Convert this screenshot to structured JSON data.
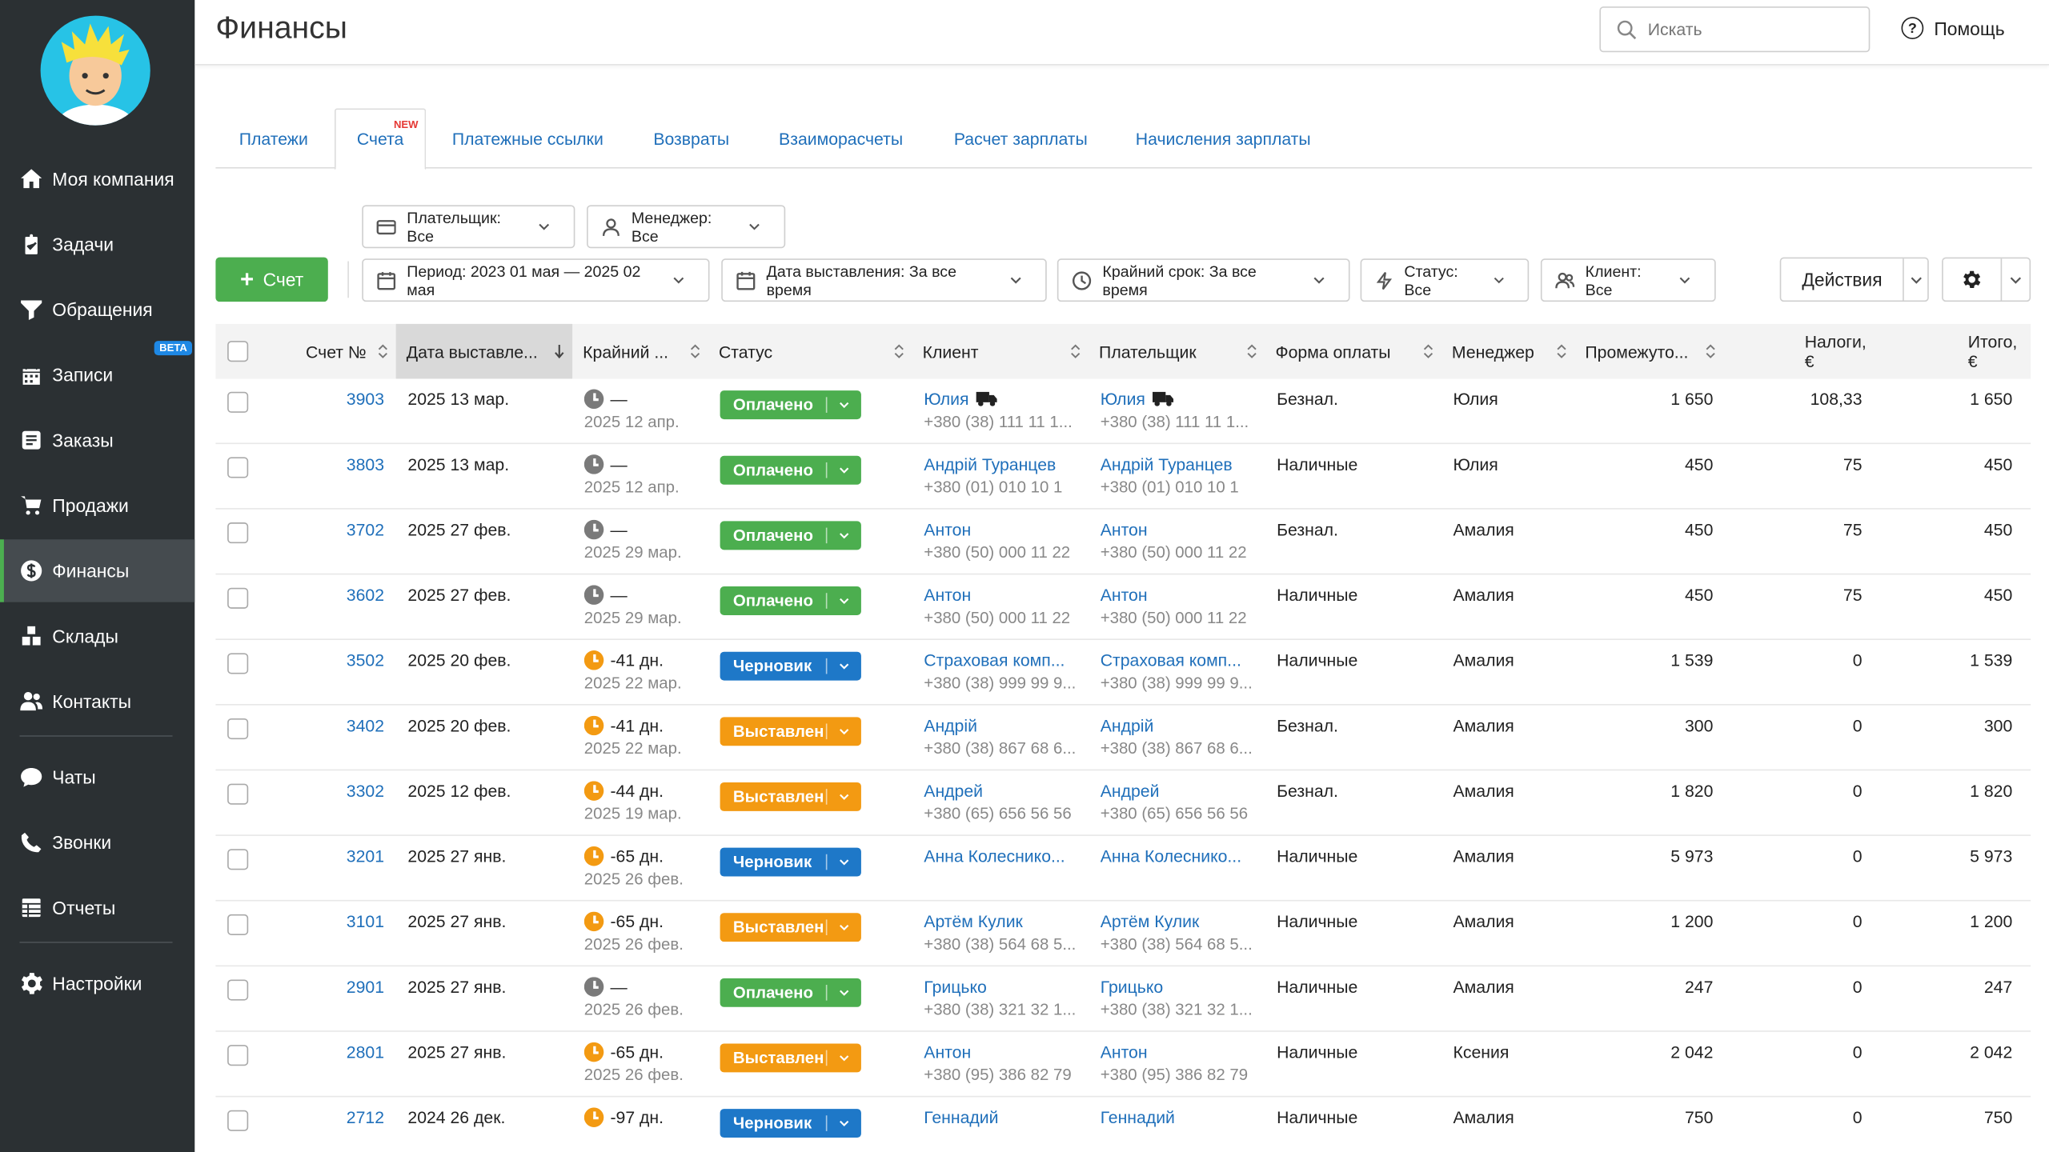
{
  "page_title": "Финансы",
  "search": {
    "placeholder": "Искать"
  },
  "help_label": "Помощь",
  "sidebar": {
    "items": [
      {
        "label": "Моя компания",
        "icon": "home-icon"
      },
      {
        "label": "Задачи",
        "icon": "clipboard-check-icon"
      },
      {
        "label": "Обращения",
        "icon": "funnel-icon"
      },
      {
        "label": "Записи",
        "icon": "calendar-icon",
        "badge": "BETA"
      },
      {
        "label": "Заказы",
        "icon": "order-icon"
      },
      {
        "label": "Продажи",
        "icon": "cart-icon"
      },
      {
        "label": "Финансы",
        "icon": "dollar-icon",
        "active": true
      },
      {
        "label": "Склады",
        "icon": "boxes-icon"
      },
      {
        "label": "Контакты",
        "icon": "users-icon"
      },
      {
        "label": "Чаты",
        "icon": "chat-icon"
      },
      {
        "label": "Звонки",
        "icon": "phone-icon"
      },
      {
        "label": "Отчеты",
        "icon": "report-icon"
      },
      {
        "label": "Настройки",
        "icon": "gear-icon"
      }
    ]
  },
  "tabs": [
    {
      "label": "Платежи"
    },
    {
      "label": "Счета",
      "badge": "NEW",
      "active": true
    },
    {
      "label": "Платежные ссылки"
    },
    {
      "label": "Возвраты"
    },
    {
      "label": "Взаиморасчеты"
    },
    {
      "label": "Расчет зарплаты"
    },
    {
      "label": "Начисления зарплаты"
    }
  ],
  "filters": {
    "payer": "Плательщик: Все",
    "manager": "Менеджер: Все",
    "period": "Период: 2023 01 мая — 2025 02 мая",
    "issue_date": "Дата выставления: За все время",
    "deadline": "Крайний срок: За все время",
    "status": "Статус: Все",
    "client": "Клиент: Все"
  },
  "add_button": "Счет",
  "actions_button": "Действия",
  "colors": {
    "paid": "#4cae4f",
    "draft": "#1e78c8",
    "issued": "#f39a12",
    "accent": "#4cae4f",
    "link": "#1f6fba"
  },
  "table": {
    "columns": [
      "Счет №",
      "Дата выставле...",
      "Крайний ...",
      "Статус",
      "Клиент",
      "Плательщик",
      "Форма оплаты",
      "Менеджер",
      "Промежуто...",
      "Налоги, €",
      "Итого, €"
    ],
    "rows": [
      {
        "num": "3903",
        "date": "2025 13 мар.",
        "due": "—",
        "due_date": "2025 12 апр.",
        "due_kind": "grey",
        "status": "Оплачено",
        "status_kind": "paid",
        "client": "Юлия",
        "client_phone": "+380 (38) 111 11 1...",
        "payer": "Юлия",
        "payer_phone": "+380 (38) 111 11 1...",
        "truck": true,
        "payment": "Безнал.",
        "manager": "Юлия",
        "subtotal": "1 650",
        "tax": "108,33",
        "total": "1 650"
      },
      {
        "num": "3803",
        "date": "2025 13 мар.",
        "due": "—",
        "due_date": "2025 12 апр.",
        "due_kind": "grey",
        "status": "Оплачено",
        "status_kind": "paid",
        "client": "Андрій Туранцев",
        "client_phone": "+380 (01) 010 10 1",
        "payer": "Андрій Туранцев",
        "payer_phone": "+380 (01) 010 10 1",
        "truck": false,
        "payment": "Наличные",
        "manager": "Юлия",
        "subtotal": "450",
        "tax": "75",
        "total": "450"
      },
      {
        "num": "3702",
        "date": "2025 27 фев.",
        "due": "—",
        "due_date": "2025 29 мар.",
        "due_kind": "grey",
        "status": "Оплачено",
        "status_kind": "paid",
        "client": "Антон",
        "client_phone": "+380 (50) 000 11 22",
        "payer": "Антон",
        "payer_phone": "+380 (50) 000 11 22",
        "truck": false,
        "payment": "Безнал.",
        "manager": "Амалия",
        "subtotal": "450",
        "tax": "75",
        "total": "450"
      },
      {
        "num": "3602",
        "date": "2025 27 фев.",
        "due": "—",
        "due_date": "2025 29 мар.",
        "due_kind": "grey",
        "status": "Оплачено",
        "status_kind": "paid",
        "client": "Антон",
        "client_phone": "+380 (50) 000 11 22",
        "payer": "Антон",
        "payer_phone": "+380 (50) 000 11 22",
        "truck": false,
        "payment": "Наличные",
        "manager": "Амалия",
        "subtotal": "450",
        "tax": "75",
        "total": "450"
      },
      {
        "num": "3502",
        "date": "2025 20 фев.",
        "due": "-41 дн.",
        "due_date": "2025 22 мар.",
        "due_kind": "orange",
        "status": "Черновик",
        "status_kind": "draft",
        "client": "Страховая комп...",
        "client_phone": "+380 (38) 999 99 9...",
        "payer": "Страховая комп...",
        "payer_phone": "+380 (38) 999 99 9...",
        "truck": false,
        "payment": "Наличные",
        "manager": "Амалия",
        "subtotal": "1 539",
        "tax": "0",
        "total": "1 539"
      },
      {
        "num": "3402",
        "date": "2025 20 фев.",
        "due": "-41 дн.",
        "due_date": "2025 22 мар.",
        "due_kind": "orange",
        "status": "Выставлен",
        "status_kind": "issued",
        "client": "Андрій",
        "client_phone": "+380 (38) 867 68 6...",
        "payer": "Андрій",
        "payer_phone": "+380 (38) 867 68 6...",
        "truck": false,
        "payment": "Безнал.",
        "manager": "Амалия",
        "subtotal": "300",
        "tax": "0",
        "total": "300"
      },
      {
        "num": "3302",
        "date": "2025 12 фев.",
        "due": "-44 дн.",
        "due_date": "2025 19 мар.",
        "due_kind": "orange",
        "status": "Выставлен",
        "status_kind": "issued",
        "client": "Андрей",
        "client_phone": "+380 (65) 656 56 56",
        "payer": "Андрей",
        "payer_phone": "+380 (65) 656 56 56",
        "truck": false,
        "payment": "Безнал.",
        "manager": "Амалия",
        "subtotal": "1 820",
        "tax": "0",
        "total": "1 820"
      },
      {
        "num": "3201",
        "date": "2025 27 янв.",
        "due": "-65 дн.",
        "due_date": "2025 26 фев.",
        "due_kind": "orange",
        "status": "Черновик",
        "status_kind": "draft",
        "client": "Анна Колеснико...",
        "client_phone": "",
        "payer": "Анна Колеснико...",
        "payer_phone": "",
        "truck": false,
        "payment": "Наличные",
        "manager": "Амалия",
        "subtotal": "5 973",
        "tax": "0",
        "total": "5 973"
      },
      {
        "num": "3101",
        "date": "2025 27 янв.",
        "due": "-65 дн.",
        "due_date": "2025 26 фев.",
        "due_kind": "orange",
        "status": "Выставлен",
        "status_kind": "issued",
        "client": "Артём Кулик",
        "client_phone": "+380 (38) 564 68 5...",
        "payer": "Артём Кулик",
        "payer_phone": "+380 (38) 564 68 5...",
        "truck": false,
        "payment": "Наличные",
        "manager": "Амалия",
        "subtotal": "1 200",
        "tax": "0",
        "total": "1 200"
      },
      {
        "num": "2901",
        "date": "2025 27 янв.",
        "due": "—",
        "due_date": "2025 26 фев.",
        "due_kind": "grey",
        "status": "Оплачено",
        "status_kind": "paid",
        "client": "Грицько",
        "client_phone": "+380 (38) 321 32 1...",
        "payer": "Грицько",
        "payer_phone": "+380 (38) 321 32 1...",
        "truck": false,
        "payment": "Наличные",
        "manager": "Амалия",
        "subtotal": "247",
        "tax": "0",
        "total": "247"
      },
      {
        "num": "2801",
        "date": "2025 27 янв.",
        "due": "-65 дн.",
        "due_date": "2025 26 фев.",
        "due_kind": "orange",
        "status": "Выставлен",
        "status_kind": "issued",
        "client": "Антон",
        "client_phone": "+380 (95) 386 82 79",
        "payer": "Антон",
        "payer_phone": "+380 (95) 386 82 79",
        "truck": false,
        "payment": "Наличные",
        "manager": "Ксения",
        "subtotal": "2 042",
        "tax": "0",
        "total": "2 042"
      },
      {
        "num": "2712",
        "date": "2024 26 дек.",
        "due": "-97 дн.",
        "due_date": "",
        "due_kind": "orange",
        "status": "Черновик",
        "status_kind": "draft",
        "client": "Геннадий",
        "client_phone": "",
        "payer": "Геннадий",
        "payer_phone": "",
        "truck": false,
        "payment": "Наличные",
        "manager": "Амалия",
        "subtotal": "750",
        "tax": "0",
        "total": "750"
      }
    ]
  }
}
